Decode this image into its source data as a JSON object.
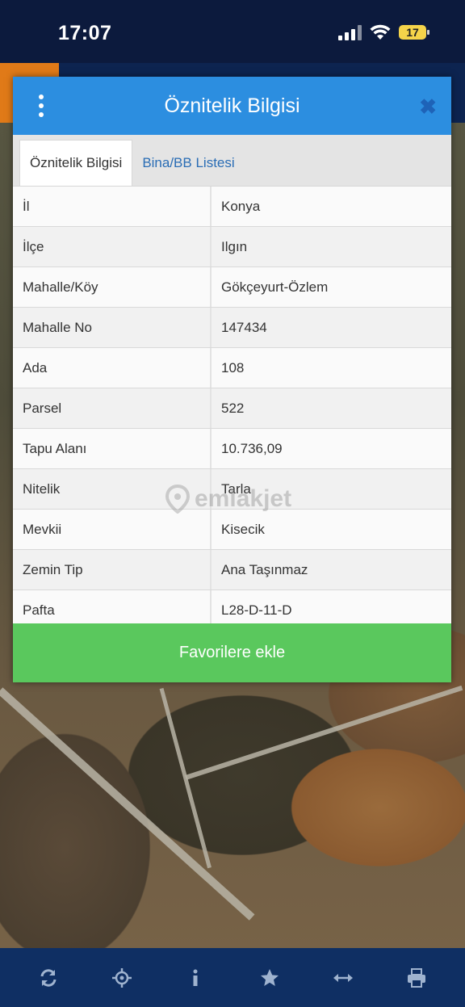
{
  "status": {
    "time": "17:07",
    "battery": "17"
  },
  "dialog": {
    "title": "Öznitelik Bilgisi",
    "tabs": [
      {
        "label": "Öznitelik Bilgisi",
        "active": true
      },
      {
        "label": "Bina/BB Listesi",
        "active": false
      }
    ],
    "rows": [
      {
        "key": "İl",
        "value": "Konya"
      },
      {
        "key": "İlçe",
        "value": "Ilgın"
      },
      {
        "key": "Mahalle/Köy",
        "value": "Gökçeyurt-Özlem"
      },
      {
        "key": "Mahalle No",
        "value": "147434"
      },
      {
        "key": "Ada",
        "value": "108"
      },
      {
        "key": "Parsel",
        "value": "522"
      },
      {
        "key": "Tapu Alanı",
        "value": "10.736,09"
      },
      {
        "key": "Nitelik",
        "value": "Tarla"
      },
      {
        "key": "Mevkii",
        "value": "Kisecik"
      },
      {
        "key": "Zemin Tip",
        "value": "Ana Taşınmaz"
      },
      {
        "key": "Pafta",
        "value": "L28-D-11-D"
      }
    ],
    "favorite_label": "Favorilere ekle"
  },
  "watermark": "emlakjet",
  "bottom_bar": [
    "refresh-icon",
    "locate-icon",
    "info-icon",
    "star-icon",
    "measure-icon",
    "print-icon"
  ],
  "colors": {
    "header": "#2c8ee0",
    "favorite": "#5ac85d",
    "bottom_bar": "#0f2f63",
    "accent_tab": "#e07a18"
  }
}
